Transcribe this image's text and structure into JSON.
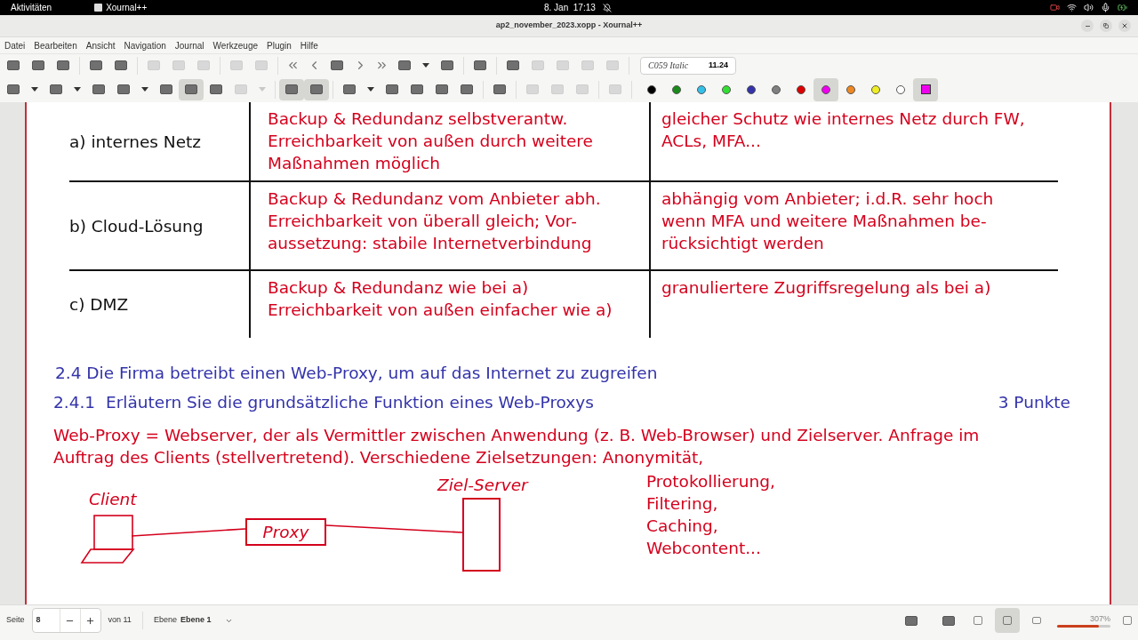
{
  "top_bar": {
    "activities": "Aktivitäten",
    "app": "Xournal++",
    "clock": "8. Jan  17:13"
  },
  "window": {
    "title": "ap2_november_2023.xopp - Xournal++"
  },
  "menu": [
    "Datei",
    "Bearbeiten",
    "Ansicht",
    "Navigation",
    "Journal",
    "Werkzeuge",
    "Plugin",
    "Hilfe"
  ],
  "toolbar_1": [
    {
      "kind": "icon",
      "disabled": false,
      "selected": false
    },
    {
      "kind": "icon",
      "disabled": false,
      "selected": false
    },
    {
      "kind": "icon",
      "disabled": false,
      "selected": false
    },
    {
      "kind": "sep"
    },
    {
      "kind": "icon",
      "disabled": false,
      "selected": false
    },
    {
      "kind": "icon",
      "disabled": false,
      "selected": false
    },
    {
      "kind": "sep"
    },
    {
      "kind": "icon",
      "disabled": true,
      "selected": false
    },
    {
      "kind": "icon",
      "disabled": true,
      "selected": false
    },
    {
      "kind": "icon",
      "disabled": true,
      "selected": false
    },
    {
      "kind": "sep"
    },
    {
      "kind": "icon",
      "disabled": true,
      "selected": false
    },
    {
      "kind": "icon",
      "disabled": true,
      "selected": false
    },
    {
      "kind": "sep"
    },
    {
      "kind": "first",
      "disabled": false
    },
    {
      "kind": "prev",
      "disabled": false
    },
    {
      "kind": "icon",
      "disabled": false,
      "selected": false
    },
    {
      "kind": "next",
      "disabled": false
    },
    {
      "kind": "last",
      "disabled": false
    },
    {
      "kind": "icon",
      "disabled": false,
      "selected": false
    },
    {
      "kind": "caret",
      "disabled": false
    },
    {
      "kind": "icon",
      "disabled": false,
      "selected": false
    },
    {
      "kind": "sep"
    },
    {
      "kind": "icon",
      "disabled": false,
      "selected": false
    },
    {
      "kind": "sep"
    },
    {
      "kind": "icon",
      "disabled": false,
      "selected": false
    },
    {
      "kind": "icon",
      "disabled": true,
      "selected": false
    },
    {
      "kind": "icon",
      "disabled": true,
      "selected": false
    },
    {
      "kind": "icon",
      "disabled": true,
      "selected": false
    },
    {
      "kind": "icon",
      "disabled": true,
      "selected": false
    },
    {
      "kind": "sep"
    }
  ],
  "font_field": {
    "font": "C059 Italic",
    "size": "11.24"
  },
  "toolbar_2": [
    {
      "kind": "icon",
      "disabled": false,
      "selected": false
    },
    {
      "kind": "caret",
      "disabled": false
    },
    {
      "kind": "icon",
      "disabled": false,
      "selected": false
    },
    {
      "kind": "caret",
      "disabled": false
    },
    {
      "kind": "icon",
      "disabled": false,
      "selected": false
    },
    {
      "kind": "icon",
      "disabled": false,
      "selected": false
    },
    {
      "kind": "caret",
      "disabled": false
    },
    {
      "kind": "icon",
      "disabled": false,
      "selected": false
    },
    {
      "kind": "icon",
      "disabled": false,
      "selected": true
    },
    {
      "kind": "icon",
      "disabled": false,
      "selected": false
    },
    {
      "kind": "icon",
      "disabled": true,
      "selected": false
    },
    {
      "kind": "caret",
      "disabled": true
    },
    {
      "kind": "sep"
    },
    {
      "kind": "icon",
      "disabled": false,
      "selected": true
    },
    {
      "kind": "icon",
      "disabled": false,
      "selected": true
    },
    {
      "kind": "sep"
    },
    {
      "kind": "icon",
      "disabled": false,
      "selected": false
    },
    {
      "kind": "caret",
      "disabled": false
    },
    {
      "kind": "icon",
      "disabled": false,
      "selected": false
    },
    {
      "kind": "icon",
      "disabled": false,
      "selected": false
    },
    {
      "kind": "icon",
      "disabled": false,
      "selected": false
    },
    {
      "kind": "icon",
      "disabled": false,
      "selected": false
    },
    {
      "kind": "sep"
    },
    {
      "kind": "icon",
      "disabled": false,
      "selected": false
    },
    {
      "kind": "sep"
    },
    {
      "kind": "icon",
      "disabled": true,
      "selected": false
    },
    {
      "kind": "icon",
      "disabled": true,
      "selected": false
    },
    {
      "kind": "icon",
      "disabled": true,
      "selected": false
    },
    {
      "kind": "sep"
    },
    {
      "kind": "icon",
      "disabled": true,
      "selected": false
    },
    {
      "kind": "sep"
    }
  ],
  "colors": [
    {
      "color": "#000000",
      "selected": false
    },
    {
      "color": "#1a8a1a",
      "selected": false
    },
    {
      "color": "#33c0e8",
      "selected": false
    },
    {
      "color": "#33dd33",
      "selected": false
    },
    {
      "color": "#3333aa",
      "selected": false
    },
    {
      "color": "#808080",
      "selected": false
    },
    {
      "color": "#dd0000",
      "selected": false
    },
    {
      "color": "#ee00ee",
      "selected": true
    },
    {
      "color": "#ee8822",
      "selected": false
    },
    {
      "color": "#eeee22",
      "selected": false
    },
    {
      "color": "#ffffff",
      "selected": false
    }
  ],
  "current_color": {
    "color": "#ee00ee"
  },
  "document": {
    "table": [
      {
        "label": "a) internes Netz",
        "column_2": [
          "Backup & Redundanz selbstverantw.",
          "Erreichbarkeit von außen durch weitere",
          "Maßnahmen möglich"
        ],
        "column_3": [
          "gleicher Schutz wie internes Netz durch FW,",
          "ACLs, MFA..."
        ]
      },
      {
        "label": "b) Cloud-Lösung",
        "column_2": [
          "Backup & Redundanz vom Anbieter abh.",
          "Erreichbarkeit von überall gleich; Vor-",
          "aussetzung: stabile Internetverbindung"
        ],
        "column_3": [
          "abhängig vom Anbieter; i.d.R. sehr hoch",
          "wenn MFA und weitere Maßnahmen be-",
          "rücksichtigt werden"
        ]
      },
      {
        "label": "c) DMZ",
        "column_2": [
          "Backup & Redundanz wie bei a)",
          "Erreichbarkeit von außen einfacher wie a)"
        ],
        "column_3": [
          "granuliertere Zugriffsregelung als bei a)"
        ]
      }
    ],
    "heading": "2.4 Die Firma betreibt einen Web-Proxy, um auf das Internet zu zugreifen",
    "task": {
      "number": "2.4.1",
      "text": "Erläutern Sie die grundsätzliche Funktion eines Web-Proxys",
      "points": "3 Punkte"
    },
    "answer": [
      "Web-Proxy = Webserver, der als Vermittler zwischen Anwendung (z. B. Web-Browser) und Zielserver. Anfrage im",
      "Auftrag des Clients (stellvertretend). Verschiedene Zielsetzungen: Anonymität,"
    ],
    "goals": [
      "Protokollierung,",
      "Filtering,",
      "Caching,",
      "Webcontent..."
    ],
    "diagram": {
      "client": "Client",
      "proxy": "Proxy",
      "server": "Ziel-Server"
    }
  },
  "status_bar": {
    "page_label": "Seite",
    "page": "8",
    "page_total": "von 11",
    "layer_label": "Ebene",
    "layer": "Ebene 1",
    "zoom": "307%",
    "zoom_slider": {
      "level": 0.78
    }
  }
}
